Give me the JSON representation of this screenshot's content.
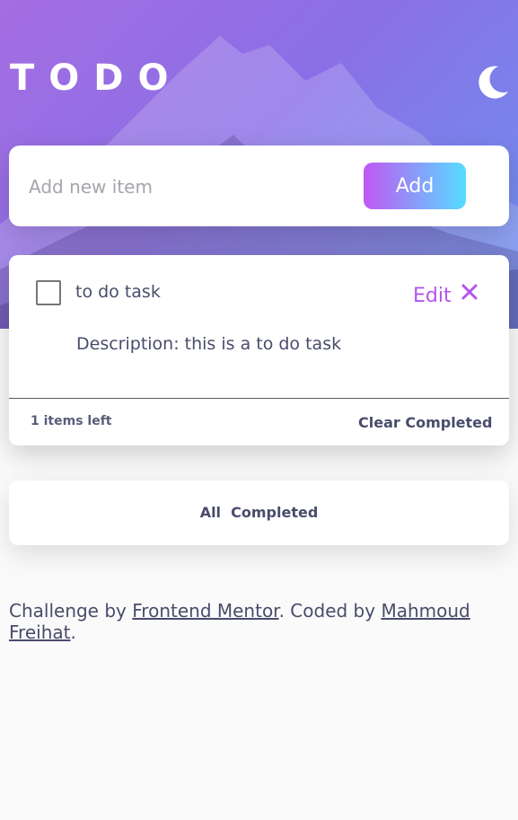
{
  "header": {
    "title": "TODO",
    "theme_icon": "moon-icon"
  },
  "add_form": {
    "placeholder": "Add new item",
    "button_label": "Add"
  },
  "todos": [
    {
      "title": "to do task",
      "description": "Description: this is a to do task",
      "edit_label": "Edit",
      "delete_icon": "close-icon",
      "completed": false
    }
  ],
  "list_footer": {
    "items_left": "1 items left",
    "clear_label": "Clear Completed"
  },
  "filters": [
    "All",
    "Completed"
  ],
  "footer": {
    "prefix": "Challenge by ",
    "mentor_link": "Frontend Mentor",
    "middle": ". Coded by ",
    "author_link": "Mahmoud Freihat",
    "suffix": "."
  },
  "colors": {
    "accent": "#b355f0",
    "gradient_start": "#c058f3",
    "gradient_end": "#55ddff",
    "text": "#494c6b",
    "background": "#fafafa"
  }
}
